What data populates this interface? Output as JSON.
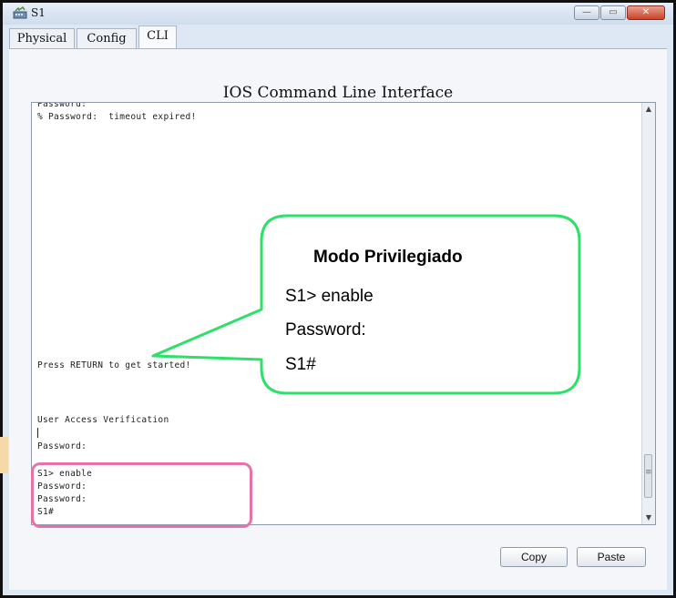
{
  "window": {
    "title": "S1"
  },
  "tabs": [
    {
      "label": "Physical"
    },
    {
      "label": "Config"
    },
    {
      "label": "CLI"
    }
  ],
  "panel": {
    "title": "IOS Command Line Interface"
  },
  "terminal": {
    "lines": [
      "Password:",
      "% Password:  timeout expired!",
      "Press RETURN to get started!",
      "User Access Verification",
      "Password:",
      "S1> enable",
      "Password:",
      "Password:",
      "S1#"
    ]
  },
  "buttons": {
    "copy": "Copy",
    "paste": "Paste"
  },
  "callout": {
    "title": "Modo Privilegiado",
    "line1": "S1> enable",
    "line2": "Password:",
    "line3": "S1#"
  },
  "icons": {
    "app": "router-switch-icon",
    "minimize": "minimize-icon",
    "maximize": "maximize-icon",
    "close": "close-icon"
  },
  "colors": {
    "callout_border": "#2ee06a",
    "highlight_border": "#e672a8"
  }
}
